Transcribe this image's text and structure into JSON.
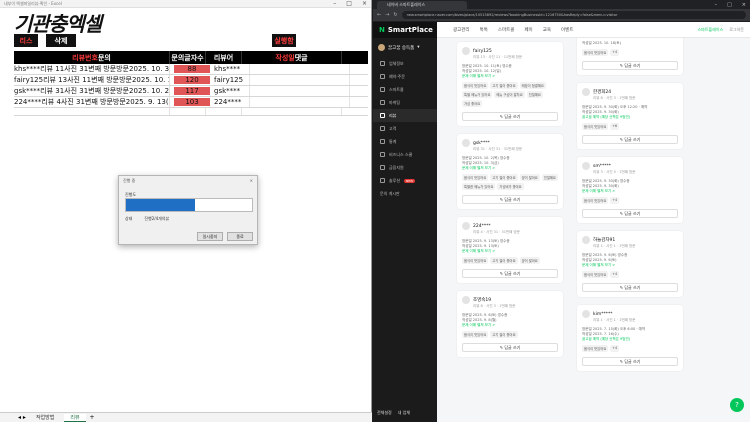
{
  "excel": {
    "window_title": "내부이 엑셀파일리뷰-확인 - Excel",
    "logo": "기관충엑셀",
    "btn_reset": "리스",
    "btn_delete": "삭제",
    "btn_run": "실행함",
    "headers": {
      "c1_red": "리뷰번호",
      "c1_white": "문의",
      "c2": "문의글자수",
      "c3": "리뷰어",
      "c4_red": "작성일",
      "c4_white": "댓글"
    },
    "rows": [
      {
        "text": "khs****리뷰 11사진 31변째 방문방문2025. 10. 30(목)",
        "count": "88",
        "reviewer": "khs****"
      },
      {
        "text": "fairy125리뷰 13사진 11변째 방문방문2025. 10. 11(토)",
        "count": "120",
        "reviewer": "fairy125"
      },
      {
        "text": "gsk****리뷰 31사진 31변째 방문방문2025. 10. 2(목)방",
        "count": "117",
        "reviewer": "gsk****"
      },
      {
        "text": "224****리뷰 4사진 31변째 방문방문2025. 9. 13(토)방",
        "count": "103",
        "reviewer": "224****"
      }
    ],
    "dialog": {
      "title": "진행 중",
      "label": "진행도",
      "progress": 0.55,
      "status_label": "상태",
      "status_value": "진행2/4개의뷰",
      "btn_pause": "일시중지",
      "btn_close": "종료"
    },
    "sheets": [
      "작업방법",
      "리뷰"
    ],
    "active_sheet": 1
  },
  "browser": {
    "tab_title": "네이버 스마트플레이스",
    "url": "new.smartplace.naver.com/bizes/place/10515892/reviews?bookingBusinessId=1216750&hasReply=false&menu=visitor",
    "brand": "SmartPlace",
    "menu": [
      "광고관리",
      "톡톡",
      "스마트콜",
      "페이",
      "교육",
      "이벤트"
    ],
    "right_links": [
      "스마트플레이스",
      "로그아웃"
    ],
    "store_name": "꿈고꿈 승득품",
    "sidebar": [
      {
        "label": "업체정보",
        "active": false
      },
      {
        "label": "예약·주문",
        "active": false
      },
      {
        "label": "스마트콜",
        "active": false
      },
      {
        "label": "마케팅",
        "active": false
      },
      {
        "label": "리뷰",
        "active": true
      },
      {
        "label": "고객",
        "active": false
      },
      {
        "label": "통계",
        "active": false
      },
      {
        "label": "비즈니스 스쿨",
        "active": false
      },
      {
        "label": "금융지원",
        "active": false
      },
      {
        "label": "솔루션",
        "active": false,
        "badge": "NEW"
      },
      {
        "label": "문의 게시판",
        "active": false
      }
    ],
    "sidebar_bottom": [
      "전체설정",
      "내 업체"
    ],
    "left_cards": [
      {
        "name": "fairy125",
        "sub": "리뷰 13 · 사진 11 · 11번째 방문",
        "visit": "방문일 2025. 10. 11(토) 영수증",
        "written": "작성일 2025. 10. 12(일)",
        "more": "문제 이해 펼쳐 보기 >",
        "tags": [
          "음식이 맛있어요",
          "고기 질이 좋아요",
          "매장이 청결해요",
          "특별 메뉴가 있어요",
          "메뉴 구성이 알차요",
          "친절해요",
          "가성 좋아요"
        ]
      },
      {
        "name": "gsk****",
        "sub": "리뷰 31 · 사진 31 · 31번째 방문",
        "visit": "방문일 2025. 10. 2(목) 영수증",
        "written": "작성일 2025. 10. 3(금)",
        "more": "문제 이해 펼쳐 보기 >",
        "tags": [
          "음식이 맛있어요",
          "고기 질이 좋아요",
          "양이 많아요",
          "친절해요",
          "특별한 메뉴가 있어요",
          "가성비가 좋아요"
        ]
      },
      {
        "name": "224****",
        "sub": "리뷰 4 · 사진 31 · 31번째 방문",
        "visit": "방문일 2025. 9. 13(토) 영수증",
        "written": "작성일 2025. 9. 13(토)",
        "more": "문제 이해 펼쳐 보기 >",
        "tags": [
          "음식이 맛있어요",
          "고기 질이 좋아요",
          "양이 많아요"
        ]
      },
      {
        "name": "조영숙19",
        "sub": "리뷰 8 · 사진 3 · 1번째 방문",
        "visit": "방문일 2025. 9. 6(토) 영수증",
        "written": "작성일 2025. 9. 8(월)",
        "more": "문제 이해 펼쳐 보기 >",
        "tags": [
          "음식이 맛있어요",
          "고기 질이 좋아요"
        ]
      }
    ],
    "right_cards": [
      {
        "name": "",
        "sub": "",
        "visit": "작성일 2025. 10. 18(토)",
        "written": "",
        "more": "",
        "tags": [
          "음식이 맛있어요",
          "+4"
        ]
      },
      {
        "name": "한경희24",
        "sub": "리뷰 8 · 사진 3 · 1번째 방문",
        "visit": "방문일 2025. 9. 30(화) 오후 12:20 · 예약",
        "written": "작성일 2025. 9. 30(화)",
        "more": "꿈고꿈 예약 (예당 산학은 9범연)",
        "tags": [
          "음식이 맛있어요",
          "+6"
        ]
      },
      {
        "name": "sm*****",
        "sub": "리뷰 3 · 사진 5 · 1번째 방문",
        "visit": "방문일 2025. 9. 30(화) 영수증",
        "written": "작성일 2025. 9. 30(화)",
        "more": "문제 이해 펼쳐 보기 >",
        "tags": [
          "음식이 맛있어요",
          "+4"
        ]
      },
      {
        "name": "하늘감자91",
        "sub": "리뷰 1 · 사진 1 · 1번째 방문",
        "visit": "방문일 2025. 9. 6(토) 영수증",
        "written": "작성일 2025. 9. 6(토)",
        "more": "문제 이해 펼쳐 보기 >",
        "tags": [
          "음식이 맛있어요",
          "+4"
        ]
      },
      {
        "name": "kim*****",
        "sub": "리뷰 1 · 사진 1 · 1번째 방문",
        "visit": "방문일 2025. 7. 15(화) 오후 6:00 · 예약",
        "written": "작성일 2025. 7. 16(수)",
        "more": "꿈고꿈 예약 (예당 산학은 9범연)",
        "tags": [
          "음식이 맛있어요",
          "+4"
        ]
      }
    ],
    "reply_label": "답글 쓰기",
    "fab_icon": "?",
    "accent": "#03c75a"
  }
}
